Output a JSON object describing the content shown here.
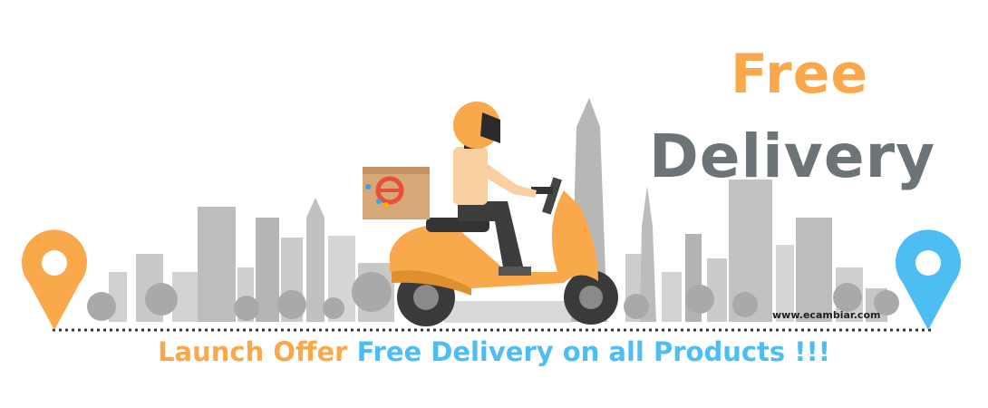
{
  "headline": {
    "line1": "Free",
    "line2": "Delivery"
  },
  "tagline": {
    "offer": "Launch Offer",
    "rest": "Free Delivery on all Products !!!"
  },
  "watermark": "www.ecambiar.com",
  "icons": {
    "left_pin": "location-pin-icon",
    "right_pin": "location-pin-icon",
    "box_logo": "e-logo-icon"
  },
  "colors": {
    "orange": "#f9a94b",
    "blue": "#4ebdf3",
    "gray_text": "#6c7478",
    "skyline": "#b9b9b9"
  }
}
